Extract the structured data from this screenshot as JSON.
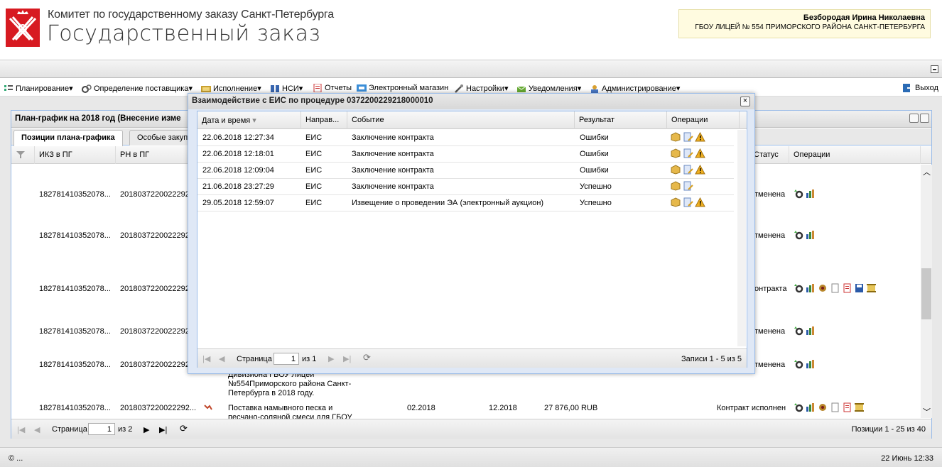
{
  "header": {
    "org_title": "Комитет по государственному заказу Санкт-Петербурга",
    "app_title": "Государственный заказ",
    "user_name": "Безбородая Ирина Николаевна",
    "user_org": "ГБОУ ЛИЦЕЙ № 554 ПРИМОРСКОГО РАЙОНА САНКТ-ПЕТЕРБУРГА"
  },
  "menu": {
    "items": [
      {
        "label": "Планирование",
        "icon": "planning-icon"
      },
      {
        "label": "Определение поставщика",
        "icon": "gears-icon"
      },
      {
        "label": "Исполнение",
        "icon": "execution-icon"
      },
      {
        "label": "НСИ",
        "icon": "book-icon"
      },
      {
        "label": "Отчеты",
        "icon": "report-icon"
      },
      {
        "label": "Электронный магазин",
        "icon": "cart-icon"
      },
      {
        "label": "Настройки",
        "icon": "wrench-icon"
      },
      {
        "label": "Уведомления",
        "icon": "notification-icon"
      },
      {
        "label": "Администрирование",
        "icon": "admin-icon"
      }
    ],
    "exit_label": "Выход"
  },
  "panel": {
    "title": "План-график на 2018 год (Внесение изме",
    "tabs": [
      "Позиции плана-графика",
      "Особые закуп"
    ],
    "columns": {
      "ikz": "ИКЗ в ПГ",
      "rn": "РН в ПГ",
      "status": "Статус",
      "ops": "Операции"
    },
    "rows": [
      {
        "ikz": "182781410352078...",
        "rn": "2018037220022292...",
        "status": "тменена"
      },
      {
        "ikz": "182781410352078...",
        "rn": "2018037220022292...",
        "status": "тменена"
      },
      {
        "ikz": "182781410352078...",
        "rn": "2018037220022292...",
        "status": "онтракта"
      },
      {
        "ikz": "182781410352078...",
        "rn": "2018037220022292...",
        "status": "тменена"
      },
      {
        "ikz": "182781410352078...",
        "rn": "2018037220022292...",
        "status": "тменена"
      },
      {
        "ikz": "182781410352078...",
        "rn": "2018037220022292...",
        "status": "Контракт исполнен"
      }
    ],
    "partial_text_1": "Дивизиона ГБОУ Лицей",
    "partial_text_2": "№554Приморского района Санкт-",
    "partial_text_3": "Петербурга в 2018 году.",
    "last_row": {
      "desc_1": "Поставка намывного песка и",
      "desc_2": "песчано-соляной смеси для ГБОУ",
      "start": "02.2018",
      "end": "12.2018",
      "amount": "27 876,00 RUB"
    },
    "pager": {
      "page_label": "Страница",
      "page_value": "1",
      "of_label": "из 2",
      "summary": "Позиции 1 - 25 из 40"
    }
  },
  "modal": {
    "title": "Взаимодействие с ЕИС по процедуре 0372200229218000010",
    "columns": {
      "datetime": "Дата и время",
      "direction": "Направ...",
      "event": "Событие",
      "result": "Результат",
      "ops": "Операции"
    },
    "rows": [
      {
        "datetime": "22.06.2018 12:27:34",
        "direction": "ЕИС",
        "event": "Заключение контракта",
        "result": "Ошибки",
        "warn": true
      },
      {
        "datetime": "22.06.2018 12:18:01",
        "direction": "ЕИС",
        "event": "Заключение контракта",
        "result": "Ошибки",
        "warn": true
      },
      {
        "datetime": "22.06.2018 12:09:04",
        "direction": "ЕИС",
        "event": "Заключение контракта",
        "result": "Ошибки",
        "warn": true
      },
      {
        "datetime": "21.06.2018 23:27:29",
        "direction": "ЕИС",
        "event": "Заключение контракта",
        "result": "Успешно",
        "warn": false
      },
      {
        "datetime": "29.05.2018 12:59:07",
        "direction": "ЕИС",
        "event": "Извещение о проведении ЭА (электронный аукцион)",
        "result": "Успешно",
        "warn": true
      }
    ],
    "pager": {
      "page_label": "Страница",
      "page_value": "1",
      "of_label": "из 1",
      "summary": "Записи 1 - 5 из 5"
    }
  },
  "footer": {
    "copyright": "© ...",
    "datetime": "22 Июнь 12:33"
  },
  "colors": {
    "panel_border": "#99bbe8",
    "logo_red": "#d71a21",
    "user_box": "#fffbe0"
  }
}
